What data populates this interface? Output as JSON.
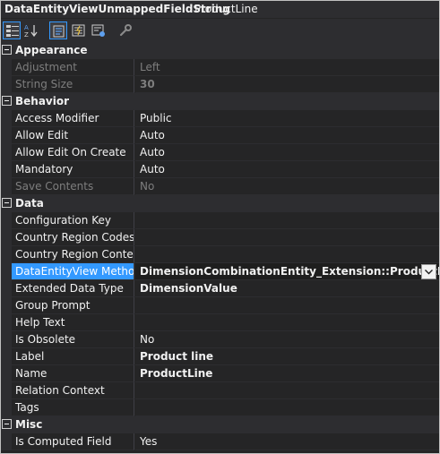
{
  "header": {
    "object_type": "DataEntityViewUnmappedFieldString",
    "object_name": "ProductLine"
  },
  "toolbar": {
    "buttons": [
      {
        "name": "categorized-icon",
        "selected": true
      },
      {
        "name": "alphabetical-icon",
        "selected": false
      },
      {
        "name": "properties-icon",
        "selected": true
      },
      {
        "name": "events-icon",
        "selected": false
      },
      {
        "name": "property-pages-icon",
        "selected": false
      },
      {
        "name": "wrench-icon",
        "selected": false
      }
    ]
  },
  "categories": [
    {
      "label": "Appearance",
      "rows": [
        {
          "name": "Adjustment",
          "value": "Left",
          "disabled": true
        },
        {
          "name": "String Size",
          "value": "30",
          "disabled": true,
          "bold": true
        }
      ]
    },
    {
      "label": "Behavior",
      "rows": [
        {
          "name": "Access Modifier",
          "value": "Public"
        },
        {
          "name": "Allow Edit",
          "value": "Auto"
        },
        {
          "name": "Allow Edit On Create",
          "value": "Auto"
        },
        {
          "name": "Mandatory",
          "value": "Auto"
        },
        {
          "name": "Save Contents",
          "value": "No",
          "disabled": true
        }
      ]
    },
    {
      "label": "Data",
      "rows": [
        {
          "name": "Configuration Key",
          "value": ""
        },
        {
          "name": "Country Region Codes",
          "value": ""
        },
        {
          "name": "Country Region Context F",
          "value": ""
        },
        {
          "name": "DataEntityView Method",
          "value": "DimensionCombinationEntity_Extension::ProductLine",
          "selected": true,
          "dropdown": true
        },
        {
          "name": "Extended Data Type",
          "value": "DimensionValue",
          "bold": true
        },
        {
          "name": "Group Prompt",
          "value": ""
        },
        {
          "name": "Help Text",
          "value": ""
        },
        {
          "name": "Is Obsolete",
          "value": "No"
        },
        {
          "name": "Label",
          "value": "Product line",
          "bold": true
        },
        {
          "name": "Name",
          "value": "ProductLine",
          "bold": true
        },
        {
          "name": "Relation Context",
          "value": ""
        },
        {
          "name": "Tags",
          "value": ""
        }
      ]
    },
    {
      "label": "Misc",
      "rows": [
        {
          "name": "Is Computed Field",
          "value": "Yes"
        }
      ]
    }
  ]
}
